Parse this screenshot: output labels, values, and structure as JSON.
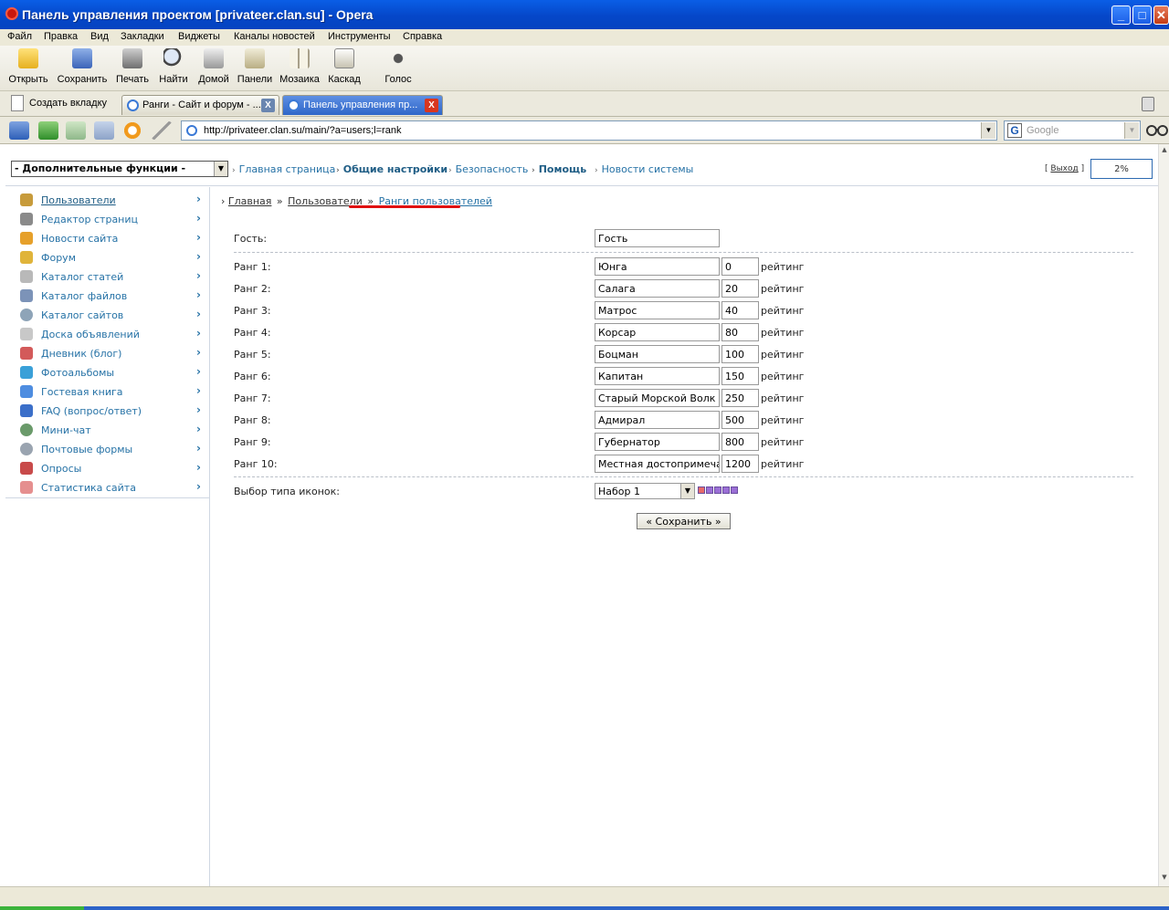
{
  "window": {
    "title": "Панель управления проектом [privateer.clan.su] - Opera",
    "min": "_",
    "max": "□",
    "close": "✕"
  },
  "menu": [
    "Файл",
    "Правка",
    "Вид",
    "Закладки",
    "Виджеты",
    "Каналы новостей",
    "Инструменты",
    "Справка"
  ],
  "toolbar": [
    "Открыть",
    "Сохранить",
    "Печать",
    "Найти",
    "Домой",
    "Панели",
    "Мозаика",
    "Каскад",
    "Голос"
  ],
  "tabs": {
    "new_tab": "Создать вкладку",
    "items": [
      "Ранги - Сайт и форум - ...",
      "Панель управления пр..."
    ],
    "close": "X"
  },
  "address": {
    "url": "http://privateer.clan.su/main/?a=users;l=rank",
    "search_placeholder": "Google",
    "search_g": "G",
    "dropdown": "▼"
  },
  "topbar": {
    "extra_select": "- Дополнительные функции -",
    "links": [
      "Главная страница",
      "Общие настройки",
      "Безопасность",
      "Помощь",
      "Новости системы"
    ],
    "bullet": "›",
    "logout_open": "[",
    "logout": "Выход",
    "logout_close": "]",
    "zoom": "2%"
  },
  "sidebar": {
    "items": [
      "Пользователи",
      "Редактор страниц",
      "Новости сайта",
      "Форум",
      "Каталог статей",
      "Каталог файлов",
      "Каталог сайтов",
      "Доска объявлений",
      "Дневник (блог)",
      "Фотоальбомы",
      "Гостевая книга",
      "FAQ (вопрос/ответ)",
      "Мини-чат",
      "Почтовые формы",
      "Опросы",
      "Статистика сайта"
    ],
    "arrow": "›"
  },
  "breadcrumb": {
    "lead": "›",
    "home": "Главная",
    "sep": "»",
    "users": "Пользователи",
    "current": "Ранги пользователей"
  },
  "form": {
    "guest_label": "Гость:",
    "guest_value": "Гость",
    "unit": "рейтинг",
    "ranks": [
      {
        "label": "Ранг 1:",
        "name": "Юнга",
        "value": "0"
      },
      {
        "label": "Ранг 2:",
        "name": "Салага",
        "value": "20"
      },
      {
        "label": "Ранг 3:",
        "name": "Матрос",
        "value": "40"
      },
      {
        "label": "Ранг 4:",
        "name": "Корсар",
        "value": "80"
      },
      {
        "label": "Ранг 5:",
        "name": "Боцман",
        "value": "100"
      },
      {
        "label": "Ранг 6:",
        "name": "Капитан",
        "value": "150"
      },
      {
        "label": "Ранг 7:",
        "name": "Старый Морской Волк",
        "value": "250"
      },
      {
        "label": "Ранг 8:",
        "name": "Адмирал",
        "value": "500"
      },
      {
        "label": "Ранг 9:",
        "name": "Губернатор",
        "value": "800"
      },
      {
        "label": "Ранг 10:",
        "name": "Местная достопримечательность",
        "value": "1200"
      }
    ],
    "icon_type_label": "Выбор типа иконок:",
    "icon_type_value": "Набор 1",
    "swatch_colors": [
      "#e86a6a",
      "#9b6fd6",
      "#9b6fd6",
      "#9b6fd6",
      "#9b6fd6"
    ],
    "save": "« Сохранить »"
  },
  "colors": {
    "link": "#2672a6",
    "highlight_underline": "#e01010"
  }
}
